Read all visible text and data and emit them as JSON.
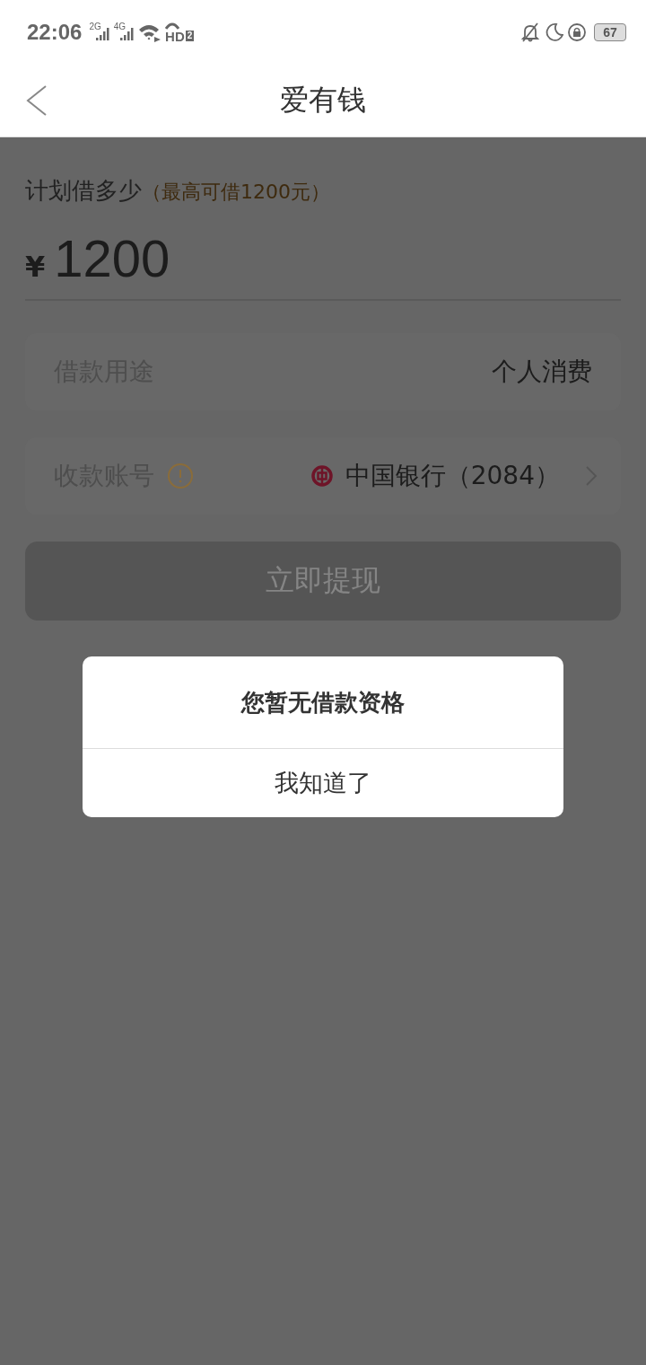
{
  "status_bar": {
    "time": "22:06",
    "sim_labels": [
      "2G",
      "4G"
    ],
    "hd_label": "HD",
    "hd_sim": "2",
    "battery": "67"
  },
  "header": {
    "title": "爱有钱"
  },
  "amount": {
    "label": "计划借多少",
    "hint": "（最高可借1200元）",
    "currency": "¥",
    "value": "1200"
  },
  "rows": [
    {
      "kind": "value",
      "label": "借款用途",
      "value": "个人消费"
    },
    {
      "kind": "account",
      "label": "收款账号",
      "value": "中国银行（2084）"
    }
  ],
  "submit": {
    "label": "立即提现",
    "disabled": true
  },
  "dialog": {
    "title": "您暂无借款资格",
    "button": "我知道了"
  }
}
